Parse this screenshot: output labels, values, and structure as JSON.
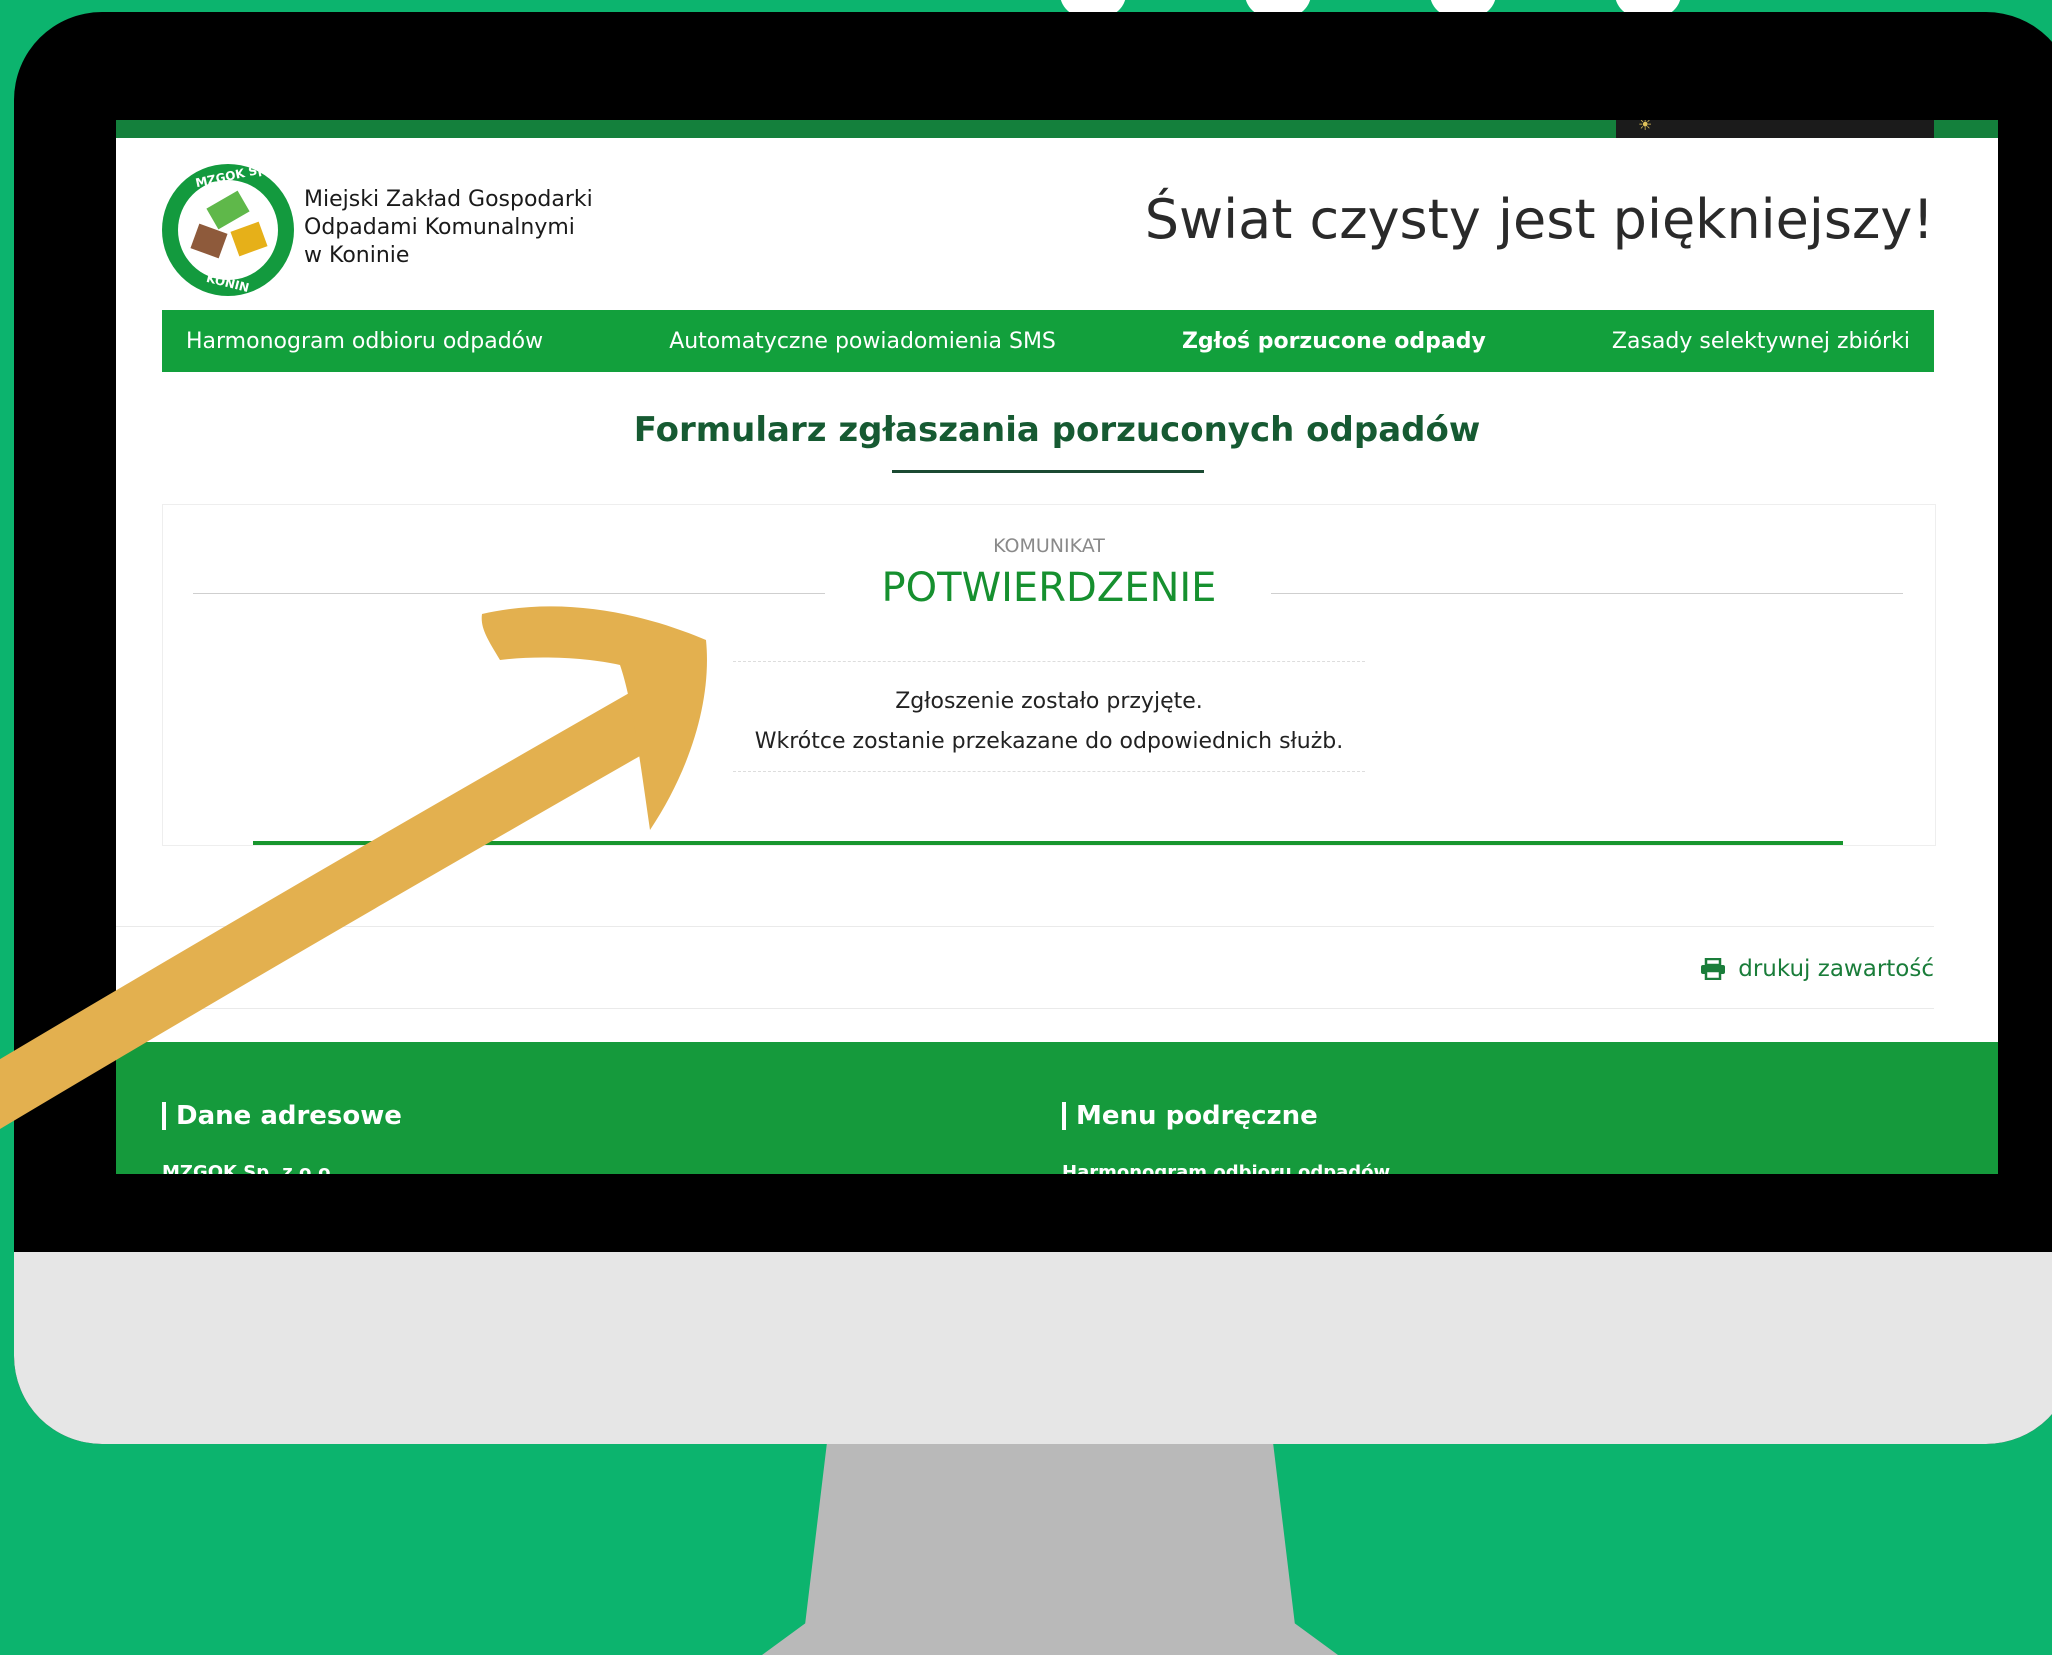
{
  "site": {
    "org_name_lines": [
      "Miejski Zakład Gospodarki",
      "Odpadami Komunalnymi",
      "w Koninie"
    ],
    "logo_top_text": "MZGOK Sp. z o.o.",
    "logo_bottom_text": "KONIN",
    "slogan": "Świat czysty jest piękniejszy!"
  },
  "nav": {
    "items": [
      {
        "label": "Harmonogram odbioru odpadów"
      },
      {
        "label": "Automatyczne powiadomienia SMS"
      },
      {
        "label": "Zgłoś porzucone odpady"
      },
      {
        "label": "Zasady selektywnej zbiórki"
      }
    ],
    "active_index": 2
  },
  "page": {
    "title": "Formularz zgłaszania porzuconych odpadów"
  },
  "message": {
    "kicker": "KOMUNIKAT",
    "heading": "POTWIERDZENIE",
    "line1": "Zgłoszenie zostało przyjęte.",
    "line2": "Wkrótce zostanie przekazane do odpowiednich służb."
  },
  "actions": {
    "print_label": "drukuj zawartość",
    "print_icon": "printer-icon"
  },
  "footer": {
    "col1_heading": "Dane adresowe",
    "col1_first_line": "MZGOK Sp. z o.o.",
    "col2_heading": "Menu podręczne",
    "col2_first_line": "Harmonogram odbioru odpadów"
  },
  "colors": {
    "background": "#0cb46e",
    "brand_green": "#12a03c",
    "arrow": "#e3b04f"
  }
}
